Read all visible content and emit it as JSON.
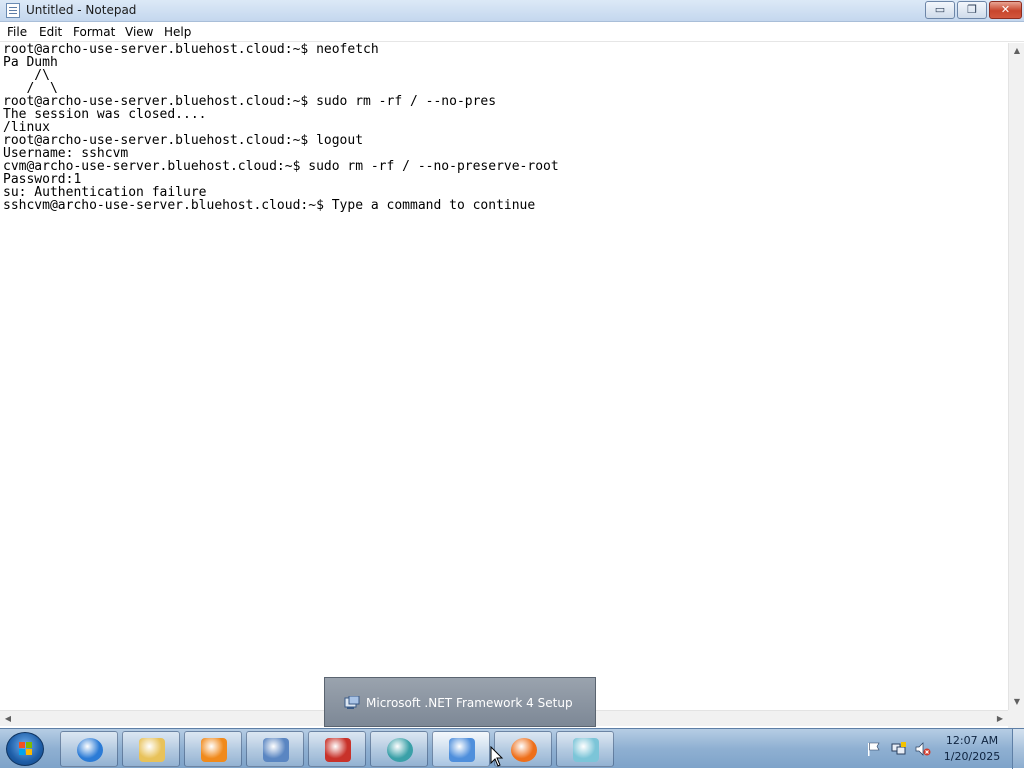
{
  "window": {
    "title": "Untitled - Notepad",
    "controls": {
      "minimize": "▭",
      "maximize": "❐",
      "close": "✕"
    }
  },
  "menu": [
    "File",
    "Edit",
    "Format",
    "View",
    "Help"
  ],
  "editor": {
    "lines": [
      "root@archo-use-server.bluehost.cloud:~$ neofetch",
      "Pa Dumh",
      "    /\\",
      "   /  \\",
      "root@archo-use-server.bluehost.cloud:~$ sudo rm -rf / --no-pres",
      "The session was closed....",
      "/linux",
      "root@archo-use-server.bluehost.cloud:~$ logout",
      "Username: sshcvm",
      "cvm@archo-use-server.bluehost.cloud:~$ sudo rm -rf / --no-preserve-root",
      "Password:1",
      "su: Authentication failure",
      "sshcvm@archo-use-server.bluehost.cloud:~$ Type a command to continue"
    ]
  },
  "taskbar": {
    "buttons": [
      {
        "name": "internet-explorer",
        "icon": "ie-icon",
        "color": "#2b7bd6"
      },
      {
        "name": "windows-explorer",
        "icon": "folder-icon",
        "color": "#e8c25a"
      },
      {
        "name": "media-player",
        "icon": "media-player-icon",
        "color": "#f08a1c"
      },
      {
        "name": "network-computer",
        "icon": "network-icon",
        "color": "#5a86c2"
      },
      {
        "name": "toolbox",
        "icon": "toolbox-icon",
        "color": "#c8322a"
      },
      {
        "name": "globe-app",
        "icon": "globe-icon",
        "color": "#3aa0a8"
      },
      {
        "name": "dotnet-setup",
        "icon": "setup-monitor-icon",
        "color": "#4f8fdc"
      },
      {
        "name": "firefox",
        "icon": "firefox-icon",
        "color": "#ee6f1a"
      },
      {
        "name": "notepad",
        "icon": "notepad-icon",
        "color": "#7cc5d8"
      }
    ],
    "tray": {
      "icons": [
        "action-center-flag-icon",
        "network-icon",
        "volume-muted-icon"
      ],
      "time": "12:07 AM",
      "date": "1/20/2025"
    }
  },
  "tooltip": {
    "text": "Microsoft .NET Framework 4 Setup",
    "icon": "setup-icon"
  }
}
